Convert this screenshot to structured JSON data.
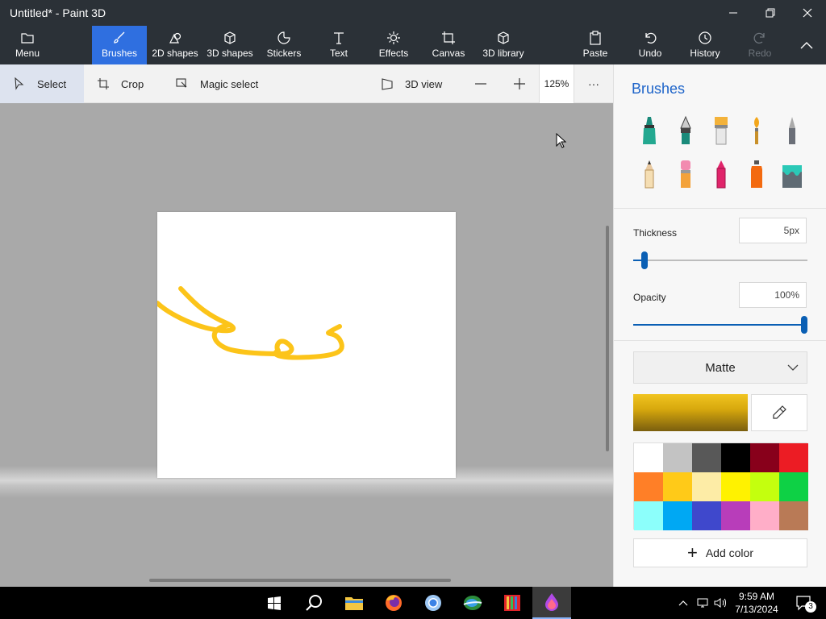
{
  "window": {
    "title": "Untitled* - Paint 3D",
    "controls": [
      "minimize-icon",
      "restore-icon",
      "close-icon"
    ]
  },
  "ribbon": {
    "menu": "Menu",
    "brushes": "Brushes",
    "shapes2d": "2D shapes",
    "shapes3d": "3D shapes",
    "stickers": "Stickers",
    "text": "Text",
    "effects": "Effects",
    "canvas": "Canvas",
    "library3d": "3D library",
    "paste": "Paste",
    "undo": "Undo",
    "history": "History",
    "redo": "Redo"
  },
  "toolbar": {
    "select": "Select",
    "crop": "Crop",
    "magic_select": "Magic select",
    "view3d": "3D view",
    "zoom": "125%",
    "more": "···"
  },
  "panel": {
    "title": "Brushes",
    "thickness_label": "Thickness",
    "thickness_value": "5px",
    "thickness_level": 0.05,
    "opacity_label": "Opacity",
    "opacity_value": "100%",
    "opacity_level": 1.0,
    "finish": "Matte",
    "current_color": "#e0b014",
    "add_color": "Add color",
    "swatches": [
      "#ffffff",
      "#c3c3c3",
      "#585858",
      "#000000",
      "#88001b",
      "#ec1c24",
      "#ff7f27",
      "#ffca18",
      "#fdeca6",
      "#fff200",
      "#c4ff0e",
      "#0ed145",
      "#8cfffb",
      "#00a8f3",
      "#3f48cc",
      "#b83dba",
      "#ffaec8",
      "#b97a56"
    ]
  },
  "accent": "#2f6fe0",
  "stroke_color": "#fcc419",
  "taskbar": {
    "time": "9:59 AM",
    "date": "7/13/2024",
    "notifications": "3"
  }
}
